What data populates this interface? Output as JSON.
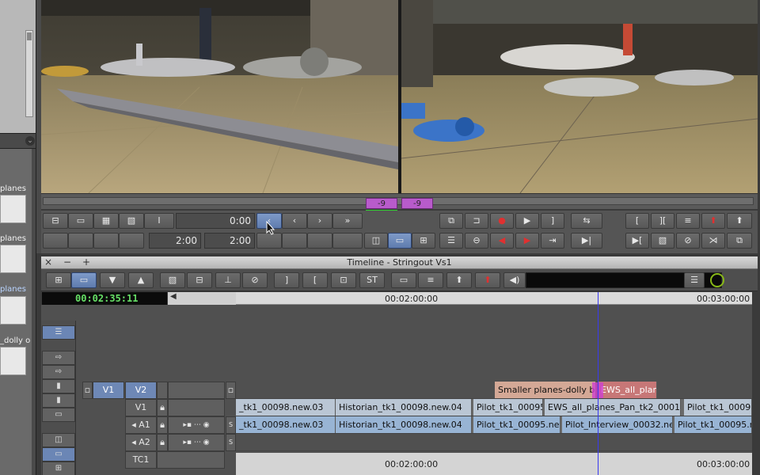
{
  "bin": {
    "items": [
      {
        "label": "planes"
      },
      {
        "label": "planes"
      },
      {
        "label": "planes"
      },
      {
        "label": "_dolly o"
      }
    ]
  },
  "monitors": {
    "source_offset": "-9",
    "record_offset": "-9"
  },
  "controls": {
    "tc_top": "0:00",
    "tc_left": "2:00",
    "tc_right": "2:00",
    "step_back_label": "‹",
    "step_fwd_label": "›",
    "fast_fwd_label": "»",
    "mark_in_label": "[",
    "mark_out_label": "]"
  },
  "timeline": {
    "title": "Timeline - Stringout Vs1",
    "close": "×",
    "minimize": "−",
    "add": "+",
    "st_label": "ST",
    "master_tc": "00:02:35:11",
    "ruler_marks": [
      "00:02:00:00",
      "00:03:00:00"
    ],
    "tracks": {
      "v2": {
        "source": "V1",
        "record": "V2"
      },
      "v1": {
        "record": "V1"
      },
      "a1": {
        "record": "◂ A1"
      },
      "a2": {
        "record": "◂ A2"
      },
      "tc1": {
        "record": "TC1"
      }
    },
    "v2_clips": [
      {
        "label": "Smaller planes-dolly b"
      },
      {
        "label": "EWS_all_plane"
      }
    ],
    "v1_clips": [
      {
        "label": "_tk1_00098.new.03"
      },
      {
        "label": "Historian_tk1_00098.new.04"
      },
      {
        "label": "Pilot_tk1_00095"
      },
      {
        "label": "EWS_all_planes_Pan_tk2_00015."
      },
      {
        "label": "Pilot_tk1_0009"
      }
    ],
    "a1_clips": [
      {
        "label": "_tk1_00098.new.03"
      },
      {
        "label": "Historian_tk1_00098.new.04"
      },
      {
        "label": "Pilot_tk1_00095.nev"
      },
      {
        "label": "Pilot_Interview_00032.nev"
      },
      {
        "label": "Pilot_tk1_00095.r"
      }
    ]
  },
  "colors": {
    "accent_blue": "#6e88b6",
    "tc_green": "#66e066",
    "offset_purple": "#b85bcb",
    "playhead": "#3a3af0"
  }
}
